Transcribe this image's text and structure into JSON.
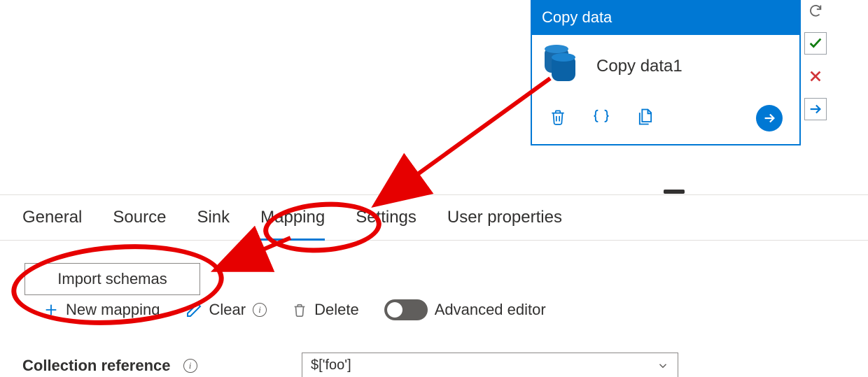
{
  "activity": {
    "header": "Copy data",
    "name": "Copy data1"
  },
  "tabs": {
    "general": "General",
    "source": "Source",
    "sink": "Sink",
    "mapping": "Mapping",
    "settings": "Settings",
    "user_properties": "User properties"
  },
  "toolbar": {
    "import_schemas": "Import schemas",
    "new_mapping": "New mapping",
    "clear": "Clear",
    "delete": "Delete",
    "advanced_editor": "Advanced editor"
  },
  "collection": {
    "label": "Collection reference",
    "value": "$['foo']"
  }
}
